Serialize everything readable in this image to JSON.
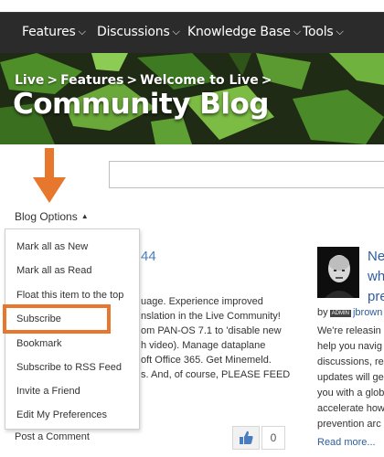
{
  "nav": {
    "items": [
      {
        "label": "Features",
        "chev": "⌵"
      },
      {
        "label": "Discussions",
        "chev": "⌵"
      },
      {
        "label": "Knowledge Base",
        "chev": "⌵"
      },
      {
        "label": "Tools",
        "chev": "⌵"
      }
    ]
  },
  "banner": {
    "breadcrumb": [
      "Live",
      "Features",
      "Welcome to Live"
    ],
    "separator": ">",
    "title": "Community Blog"
  },
  "blog_options": {
    "label": "Blog Options",
    "caret": "▲",
    "menu": [
      "Mark all as New",
      "Mark all as Read",
      "Float this item to the top",
      "Subscribe",
      "Bookmark",
      "Subscribe to RSS Feed",
      "Invite a Friend",
      "Edit My Preferences"
    ],
    "highlighted_item": "Subscribe",
    "highlight_color": "#e8772e"
  },
  "post_comment": "Post a Comment",
  "middle_post": {
    "title_fragment": "44",
    "lines": [
      "uage. Experience improved",
      "nslation in the Live Community!",
      "om PAN-OS 7.1 to 'disable new",
      "h video). Manage dataplane",
      "oft Office 365. Get Minemeld.",
      "s. And, of course, PLEASE FEED"
    ]
  },
  "kudos": {
    "icon": "thumbs-up-icon",
    "count": "0"
  },
  "right_post": {
    "title_lines": [
      "Ne",
      "wh",
      "pre"
    ],
    "by": "by",
    "badge": "ADMIN",
    "author": "jbrown",
    "lines": [
      "We're releasin",
      "help you navig",
      "discussions, re",
      "updates will ge",
      "you with a glob",
      "accelerate how",
      "prevention arc"
    ],
    "read_more": "Read more..."
  },
  "colors": {
    "nav_bg": "#2b2b2b",
    "accent_orange": "#e8772e",
    "link_blue": "#2d5d9f"
  }
}
